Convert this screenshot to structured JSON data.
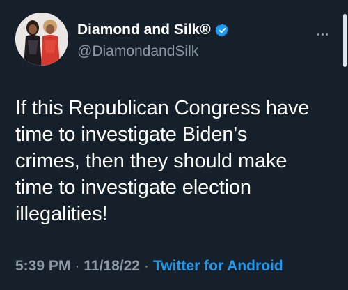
{
  "author": {
    "display_name": "Diamond and Silk®",
    "handle": "@DiamondandSilk",
    "verified_icon": "verified-badge-icon",
    "verified_color": "#1d9bf0"
  },
  "menu_icon": "more-options-icon",
  "tweet": {
    "lines": [
      "If this Republican Congress have",
      "time to investigate Biden's",
      "crimes, then they should make",
      "time to investigate election",
      "illegalities!"
    ]
  },
  "meta": {
    "time": "5:39 PM",
    "separator": "·",
    "date": "11/18/22",
    "source": "Twitter for Android"
  },
  "colors": {
    "background": "#15202b",
    "text": "#ffffff",
    "secondary": "#8b98a5",
    "accent": "#1d9bf0"
  }
}
